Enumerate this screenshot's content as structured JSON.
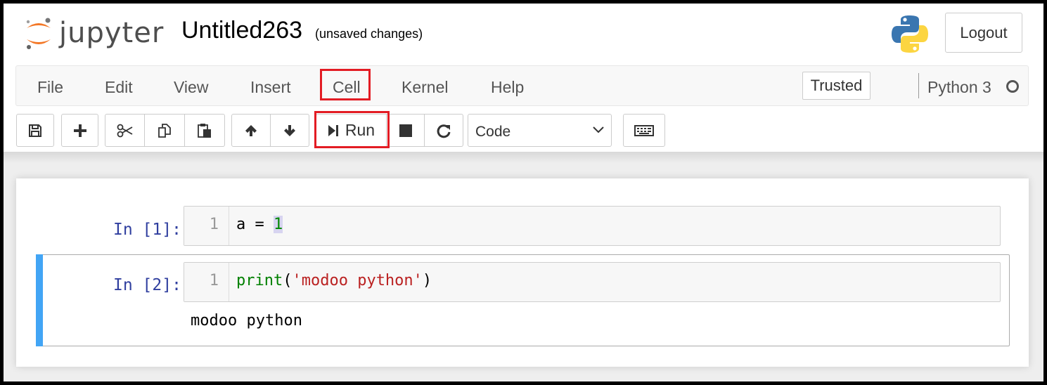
{
  "header": {
    "logo_text": "jupyter",
    "notebook_title": "Untitled263",
    "save_status": "(unsaved changes)",
    "logout_label": "Logout"
  },
  "menubar": {
    "items": [
      "File",
      "Edit",
      "View",
      "Insert",
      "Cell",
      "Kernel",
      "Help"
    ],
    "highlighted_item": "Cell",
    "trusted_label": "Trusted",
    "kernel_name": "Python 3"
  },
  "toolbar": {
    "run_label": "Run",
    "cell_type": "Code",
    "icons": [
      "save-icon",
      "plus-icon",
      "cut-icon",
      "copy-icon",
      "paste-icon",
      "arrow-up-icon",
      "arrow-down-icon",
      "step-forward-icon",
      "stop-icon",
      "refresh-icon",
      "keyboard-icon"
    ]
  },
  "cells": [
    {
      "prompt": "In [1]:",
      "line_number": "1",
      "code_tokens": [
        "a = ",
        "1"
      ]
    },
    {
      "prompt": "In [2]:",
      "line_number": "1",
      "code_tokens": [
        "print",
        "(",
        "'modoo python'",
        ")"
      ],
      "output": "modoo python",
      "selected": true
    }
  ],
  "colors": {
    "highlight_red": "#e31c24",
    "selected_cell_bar": "#42a5f5",
    "prompt_blue": "#303f9f",
    "jupyter_orange": "#f37726"
  }
}
